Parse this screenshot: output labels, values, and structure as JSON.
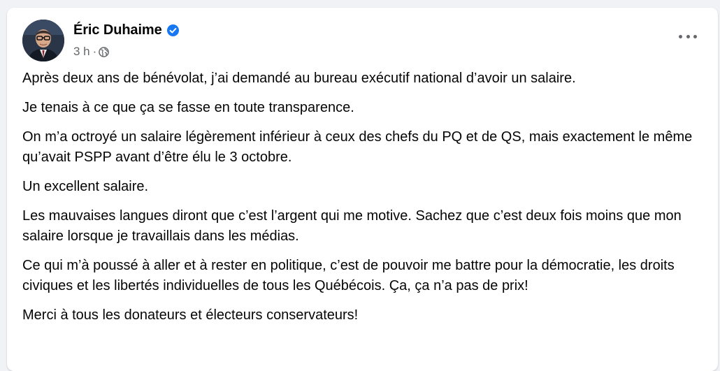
{
  "post": {
    "author": "Éric Duhaime",
    "verified": true,
    "timestamp": "3 h",
    "separator": "·",
    "privacy_icon": "globe-icon",
    "more_icon": "more-options-icon",
    "paragraphs": [
      "Après deux ans de bénévolat, j’ai demandé au bureau exécutif national d’avoir un salaire.",
      "Je tenais à ce que ça se fasse en toute transparence.",
      "On m’a octroyé un salaire légèrement inférieur à ceux des chefs du PQ et de QS, mais exactement le même qu’avait PSPP avant d’être élu le 3 octobre.",
      "Un excellent salaire.",
      "Les mauvaises langues diront que c’est l’argent qui me motive. Sachez que c’est deux fois moins que mon salaire lorsque je travaillais dans les médias.",
      "Ce qui m’à poussé à aller et à rester en politique, c’est de pouvoir me battre pour la démocratie, les droits civiques et les libertés individuelles de tous les Québécois. Ça, ça n’a pas de prix!",
      "Merci à tous les donateurs et électeurs conservateurs!"
    ]
  },
  "colors": {
    "verified_badge": "#1877f2",
    "secondary_text": "#65676b",
    "primary_text": "#050505",
    "card_background": "#ffffff",
    "page_background": "#f0f2f5"
  }
}
